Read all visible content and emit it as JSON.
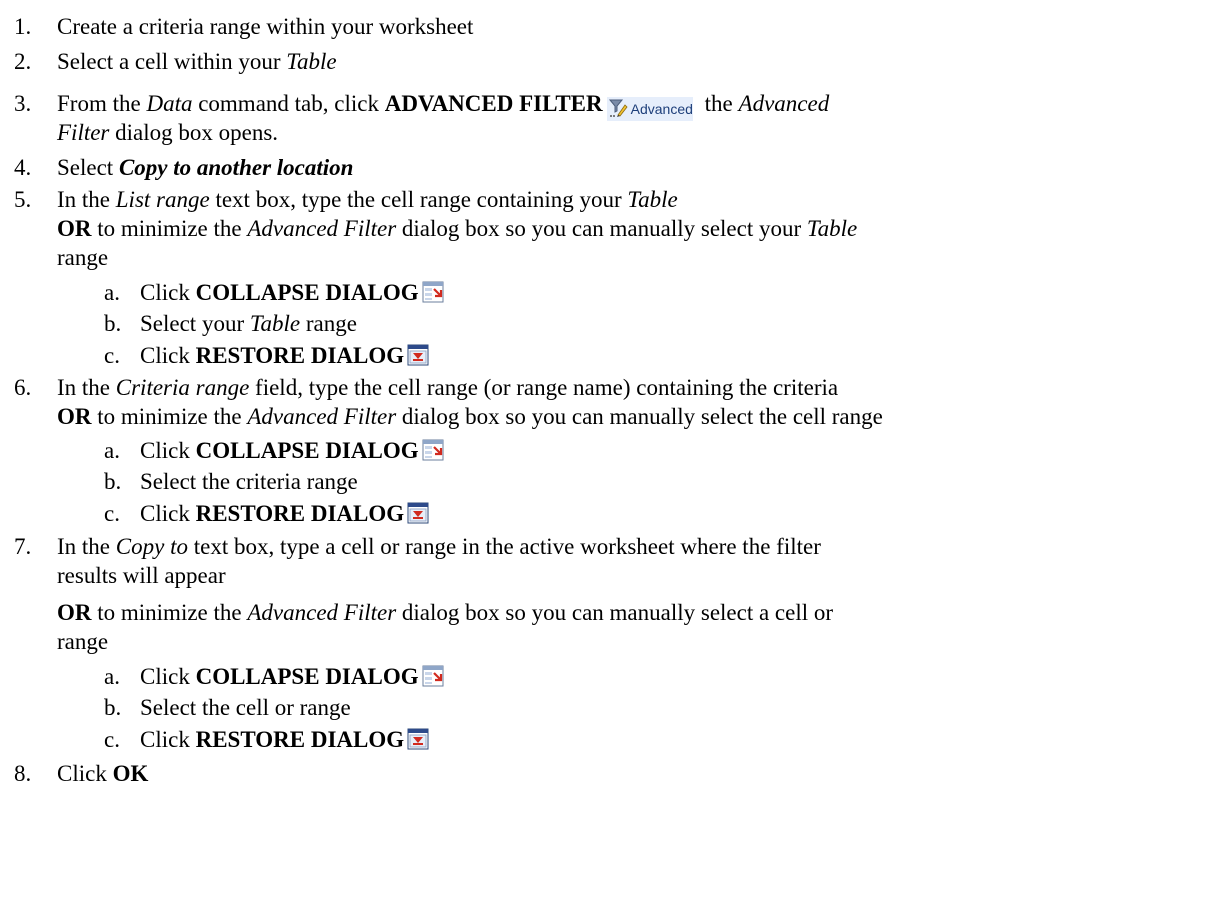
{
  "steps": [
    {
      "num": "1.",
      "text": "Create a criteria range within your worksheet"
    },
    {
      "num": "2.",
      "pre": "Select a cell within your ",
      "em": "Table"
    },
    {
      "num": "3.",
      "pre": "From the ",
      "em1": "Data",
      "mid": " command tab, click ",
      "bold": "ADVANCED FILTER",
      "post": " the ",
      "em2": "Advanced",
      "line2_em": "Filter",
      "line2_post": " dialog box opens."
    },
    {
      "num": "4.",
      "pre": "Select ",
      "bold_em": "Copy to another location"
    },
    {
      "num": "5.",
      "pre": "In the ",
      "em1": "List range",
      "mid": " text box, type the cell range containing your ",
      "em2": "Table",
      "line2_bold": "OR",
      "line2_pre": " to minimize the ",
      "line2_em": "Advanced Filter",
      "line2_mid": " dialog box so you can manually select your ",
      "line2_em2": "Table",
      "line3": "range"
    },
    {
      "num": "6.",
      "pre": "In the ",
      "em1": "Criteria range",
      "mid": " field, type the cell range (or range name) containing the criteria",
      "line2_bold": "OR",
      "line2_pre": " to minimize the ",
      "line2_em": "Advanced Filter",
      "line2_mid": " dialog box so you can manually select the cell range"
    },
    {
      "num": "7.",
      "pre": "In the ",
      "em1": "Copy to",
      "mid": " text box, type a cell or range in the active worksheet where the filter",
      "line2": "results will appear",
      "line3_bold": "OR",
      "line3_pre": " to minimize the ",
      "line3_em": "Advanced Filter",
      "line3_mid": " dialog box so you can manually select a cell or",
      "line4": "range"
    },
    {
      "num": "8.",
      "pre": "Click ",
      "bold": "OK"
    }
  ],
  "sub5": [
    {
      "num": "a.",
      "pre": "Click ",
      "bold": "COLLAPSE DIALOG"
    },
    {
      "num": "b.",
      "pre": "Select your ",
      "em": "Table",
      "post": " range"
    },
    {
      "num": "c.",
      "pre": "Click ",
      "bold": "RESTORE DIALOG"
    }
  ],
  "sub6": [
    {
      "num": "a.",
      "pre": "Click ",
      "bold": "COLLAPSE DIALOG"
    },
    {
      "num": "b.",
      "pre": "Select the criteria range"
    },
    {
      "num": "c.",
      "pre": "Click ",
      "bold": "RESTORE DIALOG"
    }
  ],
  "sub7": [
    {
      "num": "a.",
      "pre": "Click ",
      "bold": "COLLAPSE DIALOG"
    },
    {
      "num": "b.",
      "pre": "Select the cell or range"
    },
    {
      "num": "c.",
      "pre": "Click ",
      "bold": "RESTORE DIALOG"
    }
  ],
  "advanced_button": {
    "label": "Advanced",
    "icon": "advanced-filter-icon"
  },
  "icons": {
    "collapse": "collapse-dialog-icon",
    "restore": "restore-dialog-icon"
  }
}
